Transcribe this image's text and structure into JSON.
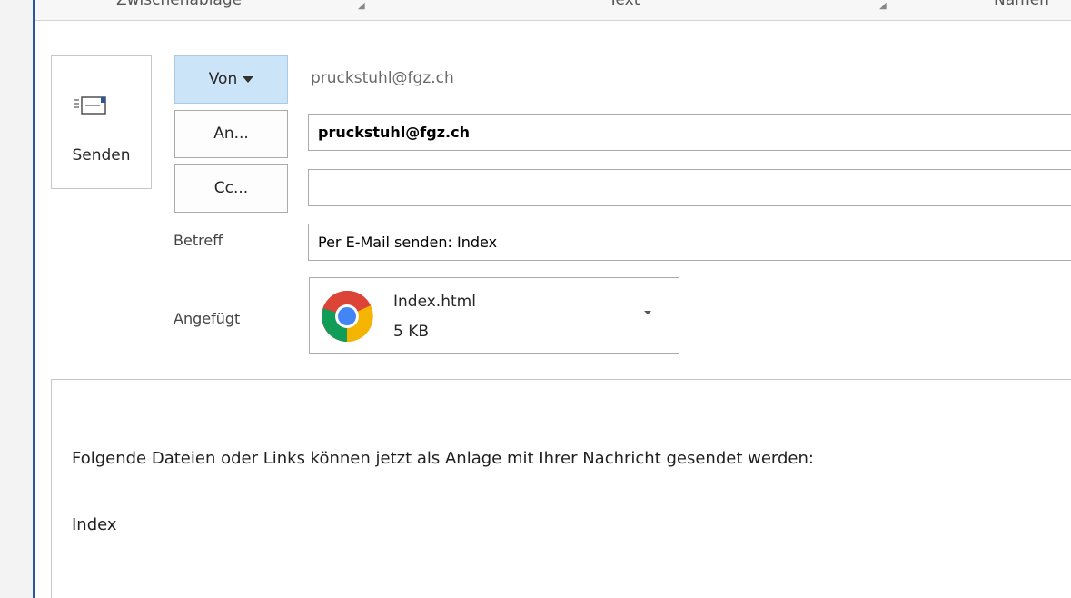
{
  "ribbon": {
    "groups": [
      "Zwischenablage",
      "Text",
      "Namen"
    ]
  },
  "send": {
    "label": "Senden",
    "icon": "send-mail-icon"
  },
  "from": {
    "button_label": "Von",
    "value": "pruckstuhl@fgz.ch"
  },
  "to": {
    "button_label": "An...",
    "value": "pruckstuhl@fgz.ch"
  },
  "cc": {
    "button_label": "Cc...",
    "value": ""
  },
  "subject": {
    "label": "Betreff",
    "value": "Per E-Mail senden: Index"
  },
  "attached": {
    "label": "Angefügt",
    "file_name": "Index.html",
    "file_size": "5 KB",
    "icon": "chrome-icon"
  },
  "message": {
    "line1": "Folgende Dateien oder Links können jetzt als Anlage mit Ihrer Nachricht gesendet werden:",
    "line2": "Index"
  },
  "colors": {
    "accent": "#2b579a",
    "von_button_bg": "#cce4f7"
  }
}
